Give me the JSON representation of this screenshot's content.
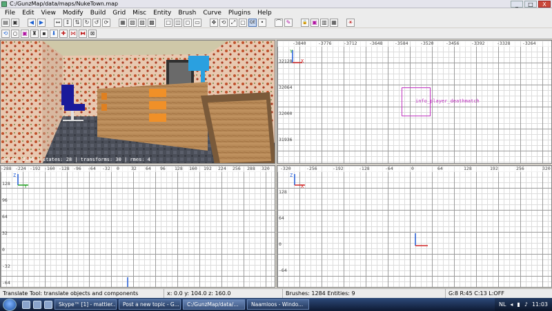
{
  "window": {
    "title": "C:/GunzMap/data/maps/NukeTown.map",
    "buttons": {
      "minimize": "_",
      "maximize": "□",
      "close": "X"
    }
  },
  "menu": [
    "File",
    "Edit",
    "View",
    "Modify",
    "Build",
    "Grid",
    "Misc",
    "Entity",
    "Brush",
    "Curve",
    "Plugins",
    "Help"
  ],
  "toolbar1": [
    {
      "name": "open-icon",
      "glyph": "▤"
    },
    {
      "name": "save-icon",
      "glyph": "▣"
    },
    {
      "gap": true
    },
    {
      "name": "undo-icon",
      "glyph": "◀",
      "color": "blue"
    },
    {
      "name": "redo-icon",
      "glyph": "▶",
      "color": "blue"
    },
    {
      "gap": true
    },
    {
      "name": "flip-x-icon",
      "glyph": "↔"
    },
    {
      "name": "flip-y-icon",
      "glyph": "↕"
    },
    {
      "name": "flip-z-icon",
      "glyph": "⇅"
    },
    {
      "name": "rotate-x-icon",
      "glyph": "↻"
    },
    {
      "name": "rotate-y-icon",
      "glyph": "↺"
    },
    {
      "name": "rotate-z-icon",
      "glyph": "⟳"
    },
    {
      "gap": true
    },
    {
      "name": "select-complete-icon",
      "glyph": "▦"
    },
    {
      "name": "select-touching-icon",
      "glyph": "▧"
    },
    {
      "name": "select-inside-icon",
      "glyph": "▨"
    },
    {
      "name": "select-partial-icon",
      "glyph": "▩"
    },
    {
      "gap": true
    },
    {
      "name": "csg-subtract-icon",
      "glyph": "□"
    },
    {
      "name": "csg-merge-icon",
      "glyph": "◫"
    },
    {
      "name": "csg-hollow-icon",
      "glyph": "◻"
    },
    {
      "name": "make-room-icon",
      "glyph": "▭"
    },
    {
      "gap": true
    },
    {
      "name": "translate-tool-icon",
      "glyph": "✥"
    },
    {
      "name": "rotate-tool-icon",
      "glyph": "⟲"
    },
    {
      "name": "scale-tool-icon",
      "glyph": "⤢"
    },
    {
      "name": "resize-tool-icon",
      "glyph": "▢"
    },
    {
      "name": "camera-clip-icon",
      "glyph": "QE",
      "active": true
    },
    {
      "name": "vertex-edit-icon",
      "glyph": "•"
    },
    {
      "gap": true
    },
    {
      "name": "patch-bend-icon",
      "glyph": "⌒"
    },
    {
      "name": "texture-lock-icon",
      "glyph": "✎",
      "color": "mag"
    },
    {
      "gap": true
    },
    {
      "name": "lock-icon",
      "glyph": "🔒"
    },
    {
      "name": "texture-browser-icon",
      "glyph": "▣",
      "color": "mag"
    },
    {
      "name": "filter-icon",
      "glyph": "▥"
    },
    {
      "name": "region-icon",
      "glyph": "▦"
    },
    {
      "gap": true
    },
    {
      "name": "plugin-icon",
      "glyph": "☀",
      "color": "red"
    }
  ],
  "toolbar2": [
    {
      "name": "refresh-icon",
      "glyph": "⟲",
      "color": "blue"
    },
    {
      "name": "circle-icon",
      "glyph": "○"
    },
    {
      "name": "texture-icon",
      "glyph": "▣",
      "color": "mag"
    },
    {
      "name": "entity-icon",
      "glyph": "♜"
    },
    {
      "name": "camera-icon",
      "glyph": "▪"
    },
    {
      "name": "down-arrow-icon",
      "glyph": "⬇",
      "color": "blue"
    },
    {
      "name": "clipper-icon",
      "glyph": "✚",
      "color": "red"
    },
    {
      "name": "split-icon",
      "glyph": "⋈",
      "color": "red"
    },
    {
      "name": "mirror-icon",
      "glyph": "⧓",
      "color": "red"
    },
    {
      "name": "no-select-icon",
      "glyph": "⊠"
    }
  ],
  "camera_view": {
    "status": "prims: 2186 | states: 28 | transforms: 30 | rmes: 4"
  },
  "xy_view": {
    "top_ticks": [
      "-3840",
      "-3776",
      "-3712",
      "-3648",
      "-3584",
      "-3520",
      "-3456",
      "-3392",
      "-3328",
      "-3264"
    ],
    "side_ticks": [
      "32128",
      "32064",
      "32000",
      "31936"
    ],
    "axis_y": "Y",
    "axis_x": "X",
    "entity_label": "info_player_deathmatch"
  },
  "xz_view": {
    "top_ticks": [
      "-288",
      "-224",
      "-192",
      "-160",
      "-128",
      "-96",
      "-64",
      "-32",
      "0",
      "32",
      "64",
      "96",
      "128",
      "160",
      "192",
      "224",
      "256",
      "288",
      "320"
    ],
    "side_ticks": [
      "128",
      "96",
      "64",
      "32",
      "0",
      "-32",
      "-64"
    ],
    "axis_z": "Z",
    "axis_x": "Y"
  },
  "yz_view": {
    "top_ticks": [
      "-320",
      "-256",
      "-192",
      "-128",
      "-64",
      "0",
      "64",
      "128",
      "192",
      "256",
      "320"
    ],
    "side_ticks": [
      "128",
      "64",
      "0",
      "-64"
    ],
    "axis_z": "Z",
    "axis_x": "X"
  },
  "statusbar": {
    "message": "Translate Tool: translate objects and components",
    "coords": "x:     0.0  y:   104.0  z:   160.0",
    "counts": "Brushes: 1284 Entities: 9",
    "grid": "G:8  R:45  C:13  L:OFF"
  },
  "taskbar": {
    "items": [
      {
        "label": "Skype™ [1] - mattier...",
        "active": false
      },
      {
        "label": "Post a new topic - G...",
        "active": false
      },
      {
        "label": "C:/GunzMap/data/...",
        "active": true
      },
      {
        "label": "Naamloos - Windo...",
        "active": false
      }
    ],
    "lang": "NL",
    "clock": "11:03"
  }
}
